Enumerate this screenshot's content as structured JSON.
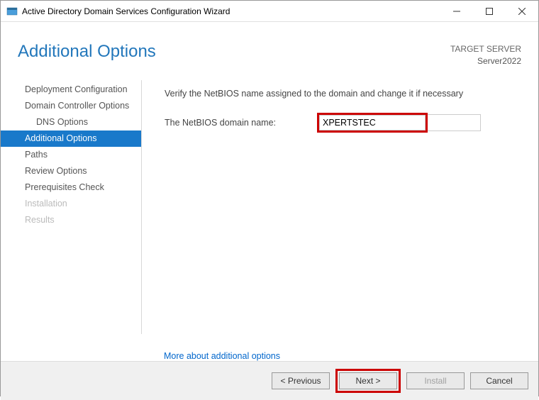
{
  "titlebar": {
    "title": "Active Directory Domain Services Configuration Wizard"
  },
  "header": {
    "page_title": "Additional Options",
    "target_label": "TARGET SERVER",
    "target_name": "Server2022"
  },
  "sidebar": {
    "items": [
      {
        "label": "Deployment Configuration"
      },
      {
        "label": "Domain Controller Options"
      },
      {
        "label": "DNS Options"
      },
      {
        "label": "Additional Options"
      },
      {
        "label": "Paths"
      },
      {
        "label": "Review Options"
      },
      {
        "label": "Prerequisites Check"
      },
      {
        "label": "Installation"
      },
      {
        "label": "Results"
      }
    ]
  },
  "content": {
    "instruction": "Verify the NetBIOS name assigned to the domain and change it if necessary",
    "field_label": "The NetBIOS domain name:",
    "field_value": "XPERTSTEC",
    "more_link": "More about additional options"
  },
  "footer": {
    "previous": "< Previous",
    "next": "Next >",
    "install": "Install",
    "cancel": "Cancel"
  }
}
